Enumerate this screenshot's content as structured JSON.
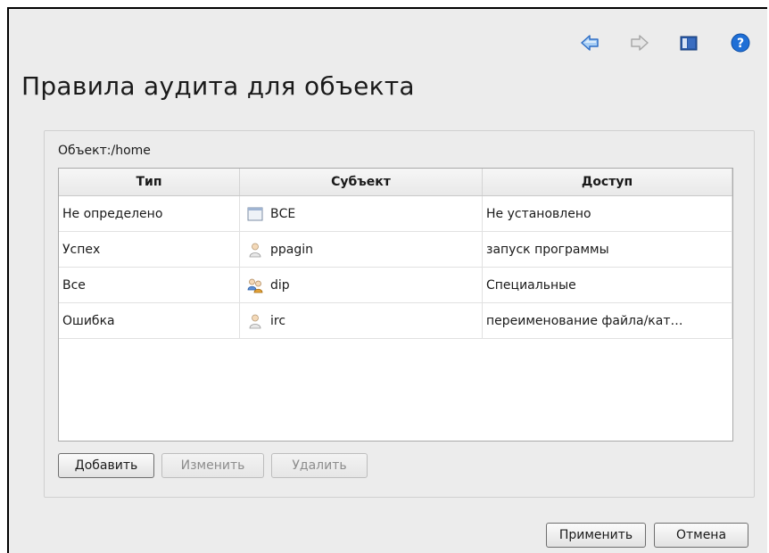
{
  "page": {
    "title": "Правила аудита для объекта"
  },
  "nav": {
    "icons": [
      "back-arrow-icon",
      "forward-arrow-icon",
      "panel-icon",
      "help-icon"
    ]
  },
  "object": {
    "label": "Объект:/home"
  },
  "table": {
    "headers": [
      "Тип",
      "Субъект",
      "Доступ"
    ],
    "rows": [
      {
        "type": "Не определено",
        "subject": "ВСЕ",
        "subject_icon": "window-icon",
        "access": "Не установлено"
      },
      {
        "type": "Успех",
        "subject": "ppagin",
        "subject_icon": "user-icon",
        "access": "запуск программы"
      },
      {
        "type": "Все",
        "subject": "dip",
        "subject_icon": "group-icon",
        "access": "Специальные"
      },
      {
        "type": "Ошибка",
        "subject": "irc",
        "subject_icon": "user-icon",
        "access": "переименование файла/кат…"
      }
    ]
  },
  "buttons": {
    "add": "Добавить",
    "edit": "Изменить",
    "delete": "Удалить",
    "apply": "Применить",
    "cancel": "Отмена"
  },
  "colors": {
    "arrow_blue": "#4a8fe0",
    "arrow_gray": "#b5b5b5",
    "help_blue": "#1f6fd6"
  }
}
